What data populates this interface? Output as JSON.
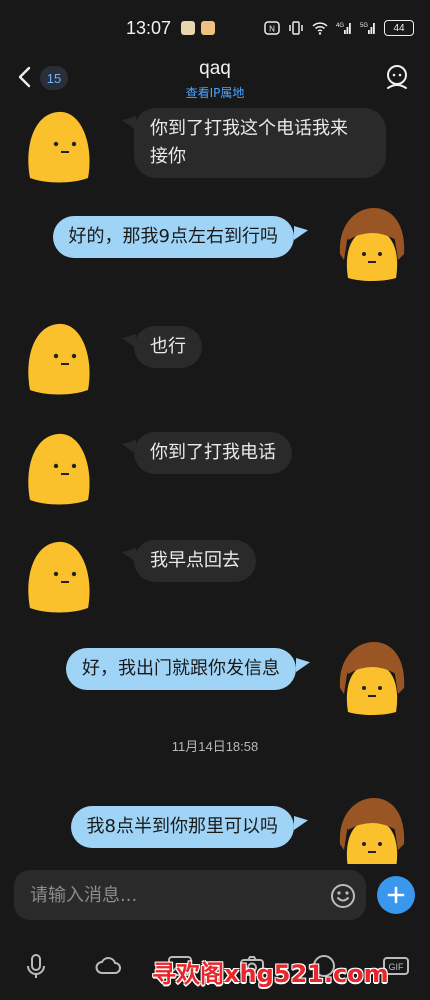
{
  "status_bar": {
    "time": "13:07",
    "battery": "44",
    "network_labels": [
      "4G",
      "5G"
    ]
  },
  "header": {
    "title": "qaq",
    "unread_count": "15",
    "ip_link": "查看IP属地"
  },
  "messages": [
    {
      "side": "left",
      "text": "你到了打我这个电话我来\n接你"
    },
    {
      "side": "right",
      "text": "好的，那我9点左右到行吗"
    },
    {
      "side": "left",
      "text": "也行"
    },
    {
      "side": "left",
      "text": "你到了打我电话"
    },
    {
      "side": "left",
      "text": "我早点回去"
    },
    {
      "side": "right",
      "text": "好，我出门就跟你发信息"
    },
    {
      "type": "timestamp",
      "text": "11月14日18:58"
    },
    {
      "side": "right",
      "text": "我8点半到你那里可以吗"
    }
  ],
  "input": {
    "placeholder": "请输入消息..."
  },
  "toolbar": {
    "icons": [
      "mic-icon",
      "cloud-icon",
      "image-icon",
      "camera-icon",
      "gif-icon",
      "video-icon"
    ],
    "gif_label": "GIF"
  },
  "watermark": "寻欢阁xhg521.com",
  "colors": {
    "background": "#181818",
    "incoming_bubble": "#2a2a2a",
    "outgoing_bubble": "#9fd4f7",
    "accent": "#3a97ee",
    "link": "#4da3ff",
    "watermark": "#e8262b"
  }
}
